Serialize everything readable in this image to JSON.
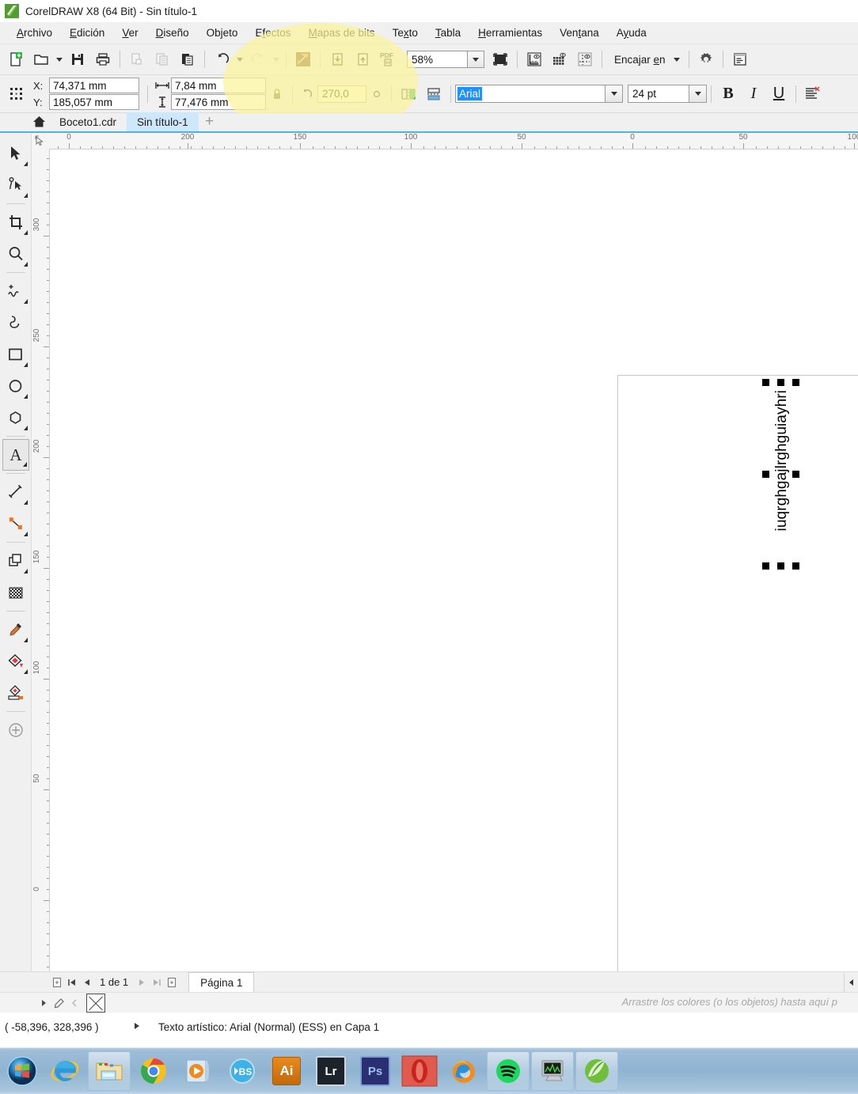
{
  "window": {
    "title": "CorelDRAW X8 (64 Bit) - Sin título-1",
    "logo_icon": "coreldraw-logo-icon"
  },
  "menubar": {
    "items": [
      {
        "label": "Archivo",
        "accel": "A"
      },
      {
        "label": "Edición",
        "accel": "E"
      },
      {
        "label": "Ver",
        "accel": "V"
      },
      {
        "label": "Diseño",
        "accel": "D"
      },
      {
        "label": "Objeto",
        "accel": "j"
      },
      {
        "label": "Efectos",
        "accel": "f"
      },
      {
        "label": "Mapas de bits",
        "accel": "M"
      },
      {
        "label": "Texto",
        "accel": "x"
      },
      {
        "label": "Tabla",
        "accel": "T"
      },
      {
        "label": "Herramientas",
        "accel": "H"
      },
      {
        "label": "Ventana",
        "accel": "t"
      },
      {
        "label": "Ayuda",
        "accel": "y"
      }
    ]
  },
  "toolbar": {
    "buttons": [
      {
        "name": "new-document-button",
        "icon": "new-page-icon",
        "enabled": true
      },
      {
        "name": "open-document-button",
        "icon": "open-folder-icon",
        "enabled": true
      },
      {
        "name": "save-button",
        "icon": "floppy-disk-icon",
        "enabled": true
      },
      {
        "name": "print-button",
        "icon": "printer-icon",
        "enabled": true
      },
      {
        "name": "cut-button",
        "icon": "scissors-icon",
        "enabled": false
      },
      {
        "name": "copy-button",
        "icon": "copy-icon",
        "enabled": false
      },
      {
        "name": "paste-button",
        "icon": "clipboard-icon",
        "enabled": true
      },
      {
        "name": "undo-button",
        "icon": "undo-arrow-icon",
        "enabled": true
      },
      {
        "name": "redo-button",
        "icon": "redo-arrow-icon",
        "enabled": false
      },
      {
        "name": "search-content-button",
        "icon": "connector-brown-icon",
        "enabled": true
      },
      {
        "name": "import-button",
        "icon": "import-down-arrow-icon",
        "enabled": true
      },
      {
        "name": "export-button",
        "icon": "export-up-arrow-icon",
        "enabled": true
      },
      {
        "name": "publish-pdf-button",
        "icon": "pdf-icon",
        "enabled": true
      }
    ],
    "zoom_value": "58%",
    "zoom_full_screen_icon": "full-screen-preview-icon",
    "view_icons": [
      {
        "name": "show-rulers-button",
        "icon": "ruler-eye-icon"
      },
      {
        "name": "show-grid-button",
        "icon": "grid-eye-icon"
      },
      {
        "name": "show-guidelines-button",
        "icon": "guideline-eye-icon"
      }
    ],
    "snap_label": "Encajar en",
    "options_icon": "gear-icon",
    "launch_icon": "document-properties-icon"
  },
  "propbar": {
    "object_position_icon": "object-origin-icon",
    "x_label": "X:",
    "x_value": "74,371 mm",
    "y_label": "Y:",
    "y_value": "185,057 mm",
    "width_icon": "width-arrows-icon",
    "width_value": "7,84 mm",
    "height_icon": "height-arrows-icon",
    "height_value": "77,476 mm",
    "lock_icon": "lock-ratio-icon",
    "rotation_icon": "rotate-icon",
    "rotation_value": "270,0",
    "rotation_unit_icon": "degree-symbol-icon",
    "mirror_horizontal_icon": "mirror-horizontal-icon",
    "mirror_vertical_icon": "mirror-vertical-icon",
    "font_name": "Arial",
    "font_size": "24 pt",
    "bold_label": "B",
    "italic_label": "I",
    "underline_label": "U",
    "text_align_icon": "text-alignment-none-icon"
  },
  "doctabs": {
    "home_icon": "home-icon",
    "tabs": [
      {
        "label": "Boceto1.cdr",
        "active": false
      },
      {
        "label": "Sin título-1",
        "active": true
      }
    ],
    "add_tab_label": "+"
  },
  "toolbox": {
    "tools": [
      {
        "name": "pick-tool",
        "icon": "pointer-arrow-icon",
        "flyout": true,
        "selected": false
      },
      {
        "name": "shape-tool",
        "icon": "node-edit-icon",
        "flyout": true,
        "selected": false
      },
      {
        "name": "crop-tool",
        "icon": "crop-icon",
        "flyout": true,
        "selected": false
      },
      {
        "name": "zoom-tool",
        "icon": "magnifier-icon",
        "flyout": true,
        "selected": false
      },
      {
        "name": "freehand-tool",
        "icon": "freehand-pencil-icon",
        "flyout": true,
        "selected": false
      },
      {
        "name": "artistic-media-tool",
        "icon": "artistic-media-swirl-icon",
        "flyout": false,
        "selected": false
      },
      {
        "name": "rectangle-tool",
        "icon": "rectangle-icon",
        "flyout": true,
        "selected": false
      },
      {
        "name": "ellipse-tool",
        "icon": "ellipse-icon",
        "flyout": true,
        "selected": false
      },
      {
        "name": "polygon-tool",
        "icon": "polygon-icon",
        "flyout": true,
        "selected": false
      },
      {
        "name": "text-tool",
        "icon": "text-a-icon",
        "flyout": true,
        "selected": true
      },
      {
        "name": "parallel-dimension-tool",
        "icon": "dimension-line-icon",
        "flyout": true,
        "selected": false
      },
      {
        "name": "straight-line-connector-tool",
        "icon": "connector-line-icon",
        "flyout": true,
        "selected": false
      },
      {
        "name": "drop-shadow-tool",
        "icon": "drop-shadow-icon",
        "flyout": true,
        "selected": false
      },
      {
        "name": "transparency-tool",
        "icon": "checkerboard-transparency-icon",
        "flyout": false,
        "selected": false
      },
      {
        "name": "color-eyedropper-tool",
        "icon": "eyedropper-icon",
        "flyout": true,
        "selected": false
      },
      {
        "name": "interactive-fill-tool",
        "icon": "fill-diamond-icon",
        "flyout": true,
        "selected": false
      },
      {
        "name": "smart-fill-tool",
        "icon": "smart-fill-icon",
        "flyout": false,
        "selected": false
      },
      {
        "name": "quick-customize-button",
        "icon": "plus-circle-icon",
        "flyout": false,
        "selected": false
      }
    ]
  },
  "canvas": {
    "ruler_h_labels": [
      "0",
      "200",
      "150",
      "100",
      "50",
      "0",
      "50",
      "100"
    ],
    "ruler_v_labels": [
      "300",
      "250",
      "200",
      "150",
      "100",
      "50",
      "0"
    ],
    "text_object": {
      "content": "iuqrghgajlrghguiayhri",
      "rotation_deg": 270
    }
  },
  "pagenav": {
    "add_page_start_icon": "add-page-before-icon",
    "first_page_icon": "first-page-icon",
    "prev_page_icon": "previous-page-icon",
    "counter": "1  de 1",
    "next_page_icon": "next-page-icon",
    "last_page_icon": "last-page-icon",
    "add_page_end_icon": "add-page-after-icon",
    "page_tab_label": "Página 1"
  },
  "palette": {
    "scroll_up_icon": "palette-scroll-up-icon",
    "pick_icon": "palette-eyedropper-icon",
    "expand_icon": "palette-expand-icon",
    "no_fill_icon": "no-fill-swatch-icon",
    "hint": "Arrastre los colores (o los objetos) hasta aquí p"
  },
  "statusbar": {
    "coords": "( -58,396, 328,396 )",
    "arrow_icon": "status-arrow-icon",
    "object_info": "Texto artístico: Arial (Normal) (ESS) en Capa 1"
  },
  "taskbar": {
    "start_icon": "windows-start-orb-icon",
    "items": [
      {
        "name": "taskbar-internet-explorer",
        "icon": "internet-explorer-icon",
        "framed": false
      },
      {
        "name": "taskbar-file-explorer",
        "icon": "file-explorer-icon",
        "framed": true
      },
      {
        "name": "taskbar-google-chrome",
        "icon": "chrome-icon",
        "framed": false
      },
      {
        "name": "taskbar-media-player",
        "icon": "windows-media-player-icon",
        "framed": false
      },
      {
        "name": "taskbar-bs-player",
        "icon": "bs-player-icon",
        "framed": false
      },
      {
        "name": "taskbar-illustrator",
        "icon": "adobe-illustrator-icon",
        "framed": false,
        "label": "Ai"
      },
      {
        "name": "taskbar-lightroom",
        "icon": "adobe-lightroom-icon",
        "framed": false,
        "label": "Lr"
      },
      {
        "name": "taskbar-photoshop",
        "icon": "adobe-photoshop-icon",
        "framed": false,
        "label": "Ps"
      },
      {
        "name": "taskbar-opera",
        "icon": "opera-icon",
        "framed": false
      },
      {
        "name": "taskbar-firefox",
        "icon": "firefox-icon",
        "framed": false
      },
      {
        "name": "taskbar-spotify",
        "icon": "spotify-icon",
        "framed": true
      },
      {
        "name": "taskbar-monitor-app",
        "icon": "monitor-chart-icon",
        "framed": true
      },
      {
        "name": "taskbar-coreldraw",
        "icon": "coreldraw-icon",
        "framed": true
      }
    ]
  },
  "colors": {
    "accent_blue": "#4ab4e6",
    "tab_active": "#cfe7fa",
    "highlight_yellow": "#fbf49a",
    "selection_blue": "#1e90ff",
    "taskbar_blue": "#8fb3d1"
  }
}
